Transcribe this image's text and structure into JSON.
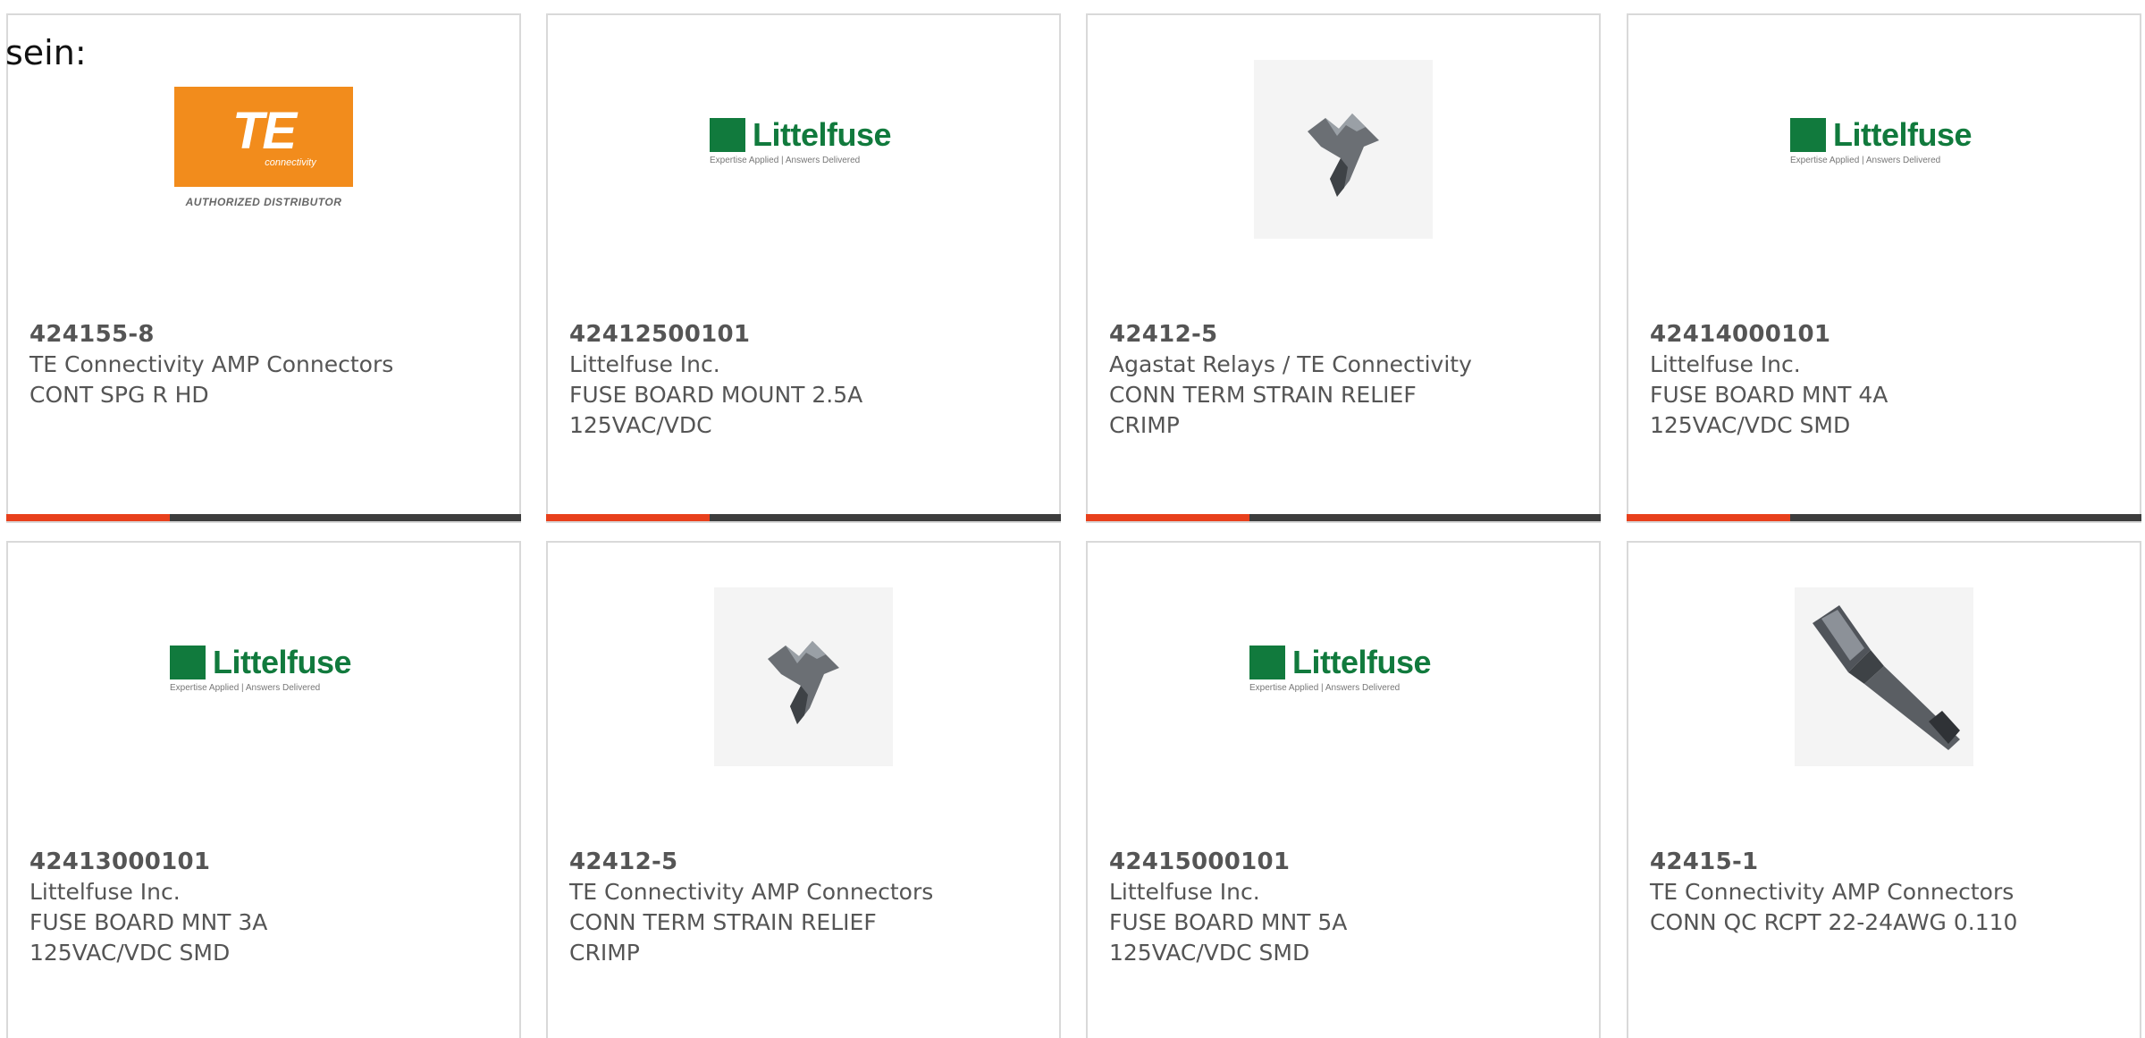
{
  "intro_text": "sein:",
  "accent_color": "#e8401c",
  "bar_color": "#3d3d3d",
  "products": [
    {
      "part_number": "424155-8",
      "manufacturer": "TE Connectivity AMP Connectors",
      "desc_line1": "CONT SPG R HD",
      "desc_line2": "",
      "image": "te-logo"
    },
    {
      "part_number": "42412500101",
      "manufacturer": "Littelfuse Inc.",
      "desc_line1": "FUSE BOARD MOUNT 2.5A",
      "desc_line2": "125VAC/VDC",
      "image": "littelfuse-logo"
    },
    {
      "part_number": "42412-5",
      "manufacturer": "Agastat Relays / TE Connectivity",
      "desc_line1": "CONN TERM STRAIN RELIEF",
      "desc_line2": "CRIMP",
      "image": "strain-relief-photo"
    },
    {
      "part_number": "42414000101",
      "manufacturer": "Littelfuse Inc.",
      "desc_line1": "FUSE BOARD MNT 4A",
      "desc_line2": "125VAC/VDC SMD",
      "image": "littelfuse-logo"
    },
    {
      "part_number": "42413000101",
      "manufacturer": "Littelfuse Inc.",
      "desc_line1": "FUSE BOARD MNT 3A",
      "desc_line2": "125VAC/VDC SMD",
      "image": "littelfuse-logo"
    },
    {
      "part_number": "42412-5",
      "manufacturer": "TE Connectivity AMP Connectors",
      "desc_line1": "CONN TERM STRAIN RELIEF",
      "desc_line2": "CRIMP",
      "image": "strain-relief-photo"
    },
    {
      "part_number": "42415000101",
      "manufacturer": "Littelfuse Inc.",
      "desc_line1": "FUSE BOARD MNT 5A",
      "desc_line2": "125VAC/VDC SMD",
      "image": "littelfuse-logo"
    },
    {
      "part_number": "42415-1",
      "manufacturer": "TE Connectivity AMP Connectors",
      "desc_line1": "CONN QC RCPT 22-24AWG 0.110",
      "desc_line2": "",
      "image": "quick-connect-photo"
    }
  ],
  "logos": {
    "te": {
      "mark": "TE",
      "sub": "connectivity",
      "caption": "AUTHORIZED DISTRIBUTOR"
    },
    "littelfuse": {
      "word": "Littelfuse",
      "tagline": "Expertise Applied | Answers Delivered"
    }
  }
}
